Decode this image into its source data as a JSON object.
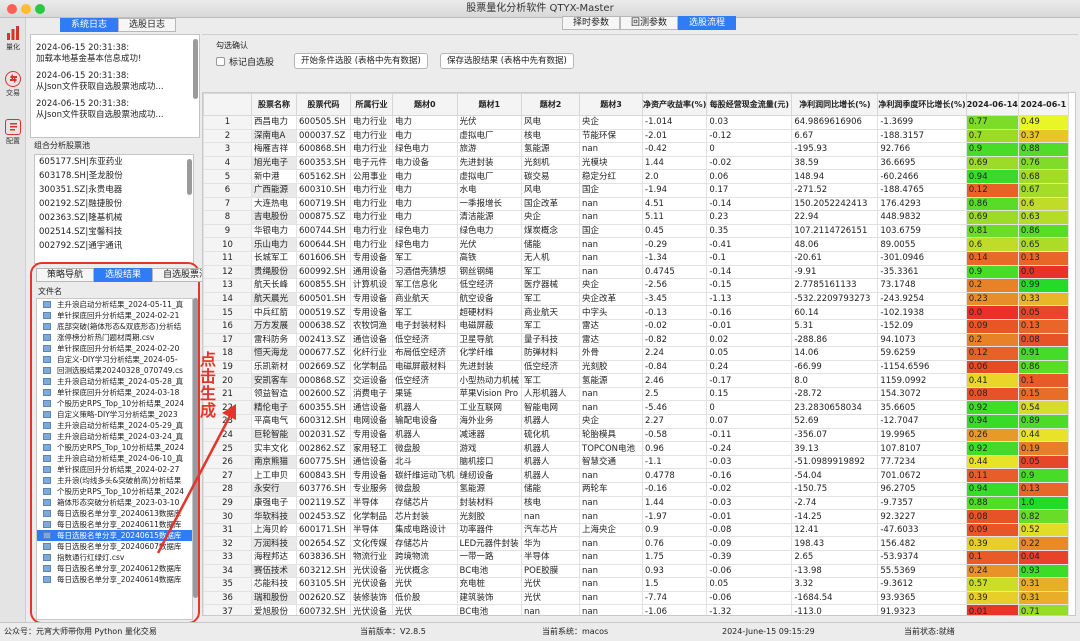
{
  "window": {
    "title": "股票量化分析软件 QTYX-Master"
  },
  "nav": [
    {
      "label": "量化",
      "icon": "bars-icon"
    },
    {
      "label": "交易",
      "icon": "exchange-icon"
    },
    {
      "label": "配置",
      "icon": "document-icon"
    }
  ],
  "left": {
    "log_tabs": [
      "系统日志",
      "选股日志"
    ],
    "logs": [
      {
        "time": "2024-06-15 20:31:38:",
        "msg": "加载本地基金基本信息成功!"
      },
      {
        "time": "2024-06-15 20:31:38:",
        "msg": "从Json文件获取自选股票池成功..."
      },
      {
        "time": "2024-06-15 20:31:38:",
        "msg": "从Json文件获取自选股票池成功..."
      }
    ],
    "pool_title": "组合分析股票池",
    "pool": [
      "605177.SH|东亚药业",
      "603178.SH|圣龙股份",
      "300351.SZ|永贵电器",
      "002192.SZ|融捷股份",
      "002363.SZ|隆基机械",
      "002514.SZ|宝馨科技",
      "002792.SZ|通宇通讯"
    ],
    "file_tabs": [
      "策略导航",
      "选股结果",
      "自选股票池"
    ],
    "tree_header": "文件名",
    "files": [
      "主升浪启动分析结果_2024-05-11_真",
      "单针探底回升分析结果_2024-02-21",
      "底部突破(箱体形态&双底形态)分析结",
      "涨停榜分析热门题材周期.csv",
      "单针探底回升分析结果_2024-02-20",
      "自定义-DIY学习分析结果_2024-05-",
      "回测选股结果20240328_070749.cs",
      "主升浪启动分析结果_2024-05-28_真",
      "单针探底回升分析结果_2024-03-18",
      "个股历史RPS_Top_10分析结果_2024",
      "自定义策略-DIY学习分析结果_2023",
      "主升浪启动分析结果_2024-05-29_真",
      "主升浪启动分析结果_2024-03-24_真",
      "个股历史RPS_Top_10分析结果_2024",
      "主升浪启动分析结果_2024-06-10_真",
      "单针探底回升分析结果_2024-02-27",
      "主升浪(均线多头&突破前高)分析结果",
      "个股历史RPS_Top_10分析结果_2024",
      "箱体形态突破分析结果_2023-03-10",
      "每日选股名单分享_20240613数据库",
      "每日选股名单分享_20240611数据库",
      "每日选股名单分享_20240615数据库",
      "每日选股名单分享_20240607数据库",
      "指数通行红绿灯.csv",
      "每日选股名单分享_20240612数据库",
      "每日选股名单分享_20240614数据库"
    ],
    "selected_index": 21
  },
  "top": {
    "tabs": [
      "择时参数",
      "回测参数",
      "选股流程"
    ],
    "active_tab": 2,
    "check_group": "勾选确认",
    "checkbox": "标记自选股",
    "btn_start": "开始条件选股 (表格中先有数据)",
    "btn_save": "保存选股结果 (表格中先有数据)"
  },
  "annotation": "点击生成",
  "table": {
    "headers": [
      "",
      "股票名称",
      "股票代码",
      "所属行业",
      "题材0",
      "题材1",
      "题材2",
      "题材3",
      "净资产收益率(%)",
      "每股经营现金流量(元)",
      "净利润同比增长(%)",
      "净利润季度环比增长(%)",
      "2024-06-14",
      "2024-06-1"
    ],
    "rows": [
      [
        "1",
        "西昌电力",
        "600505.SH",
        "电力行业",
        "电力",
        "光伏",
        "风电",
        "央企",
        "-1.014",
        "0.03",
        "64.9869616906",
        "-1.3699",
        "0.77",
        "0.49"
      ],
      [
        "2",
        "深南电A",
        "000037.SZ",
        "电力行业",
        "电力",
        "虚拟电厂",
        "核电",
        "节能环保",
        "-2.01",
        "-0.12",
        "6.67",
        "-188.3157",
        "0.7",
        "0.37"
      ],
      [
        "3",
        "梅雁吉祥",
        "600868.SH",
        "电力行业",
        "绿色电力",
        "旅游",
        "氢能源",
        "nan",
        "-0.42",
        "0",
        "-195.93",
        "92.766",
        "0.9",
        "0.88"
      ],
      [
        "4",
        "旭光电子",
        "600353.SH",
        "电子元件",
        "电力设备",
        "先进封装",
        "光刻机",
        "光模块",
        "1.44",
        "-0.02",
        "38.59",
        "36.6695",
        "0.69",
        "0.76"
      ],
      [
        "5",
        "新中港",
        "605162.SH",
        "公用事业",
        "电力",
        "虚拟电厂",
        "碳交易",
        "稳定分红",
        "2.0",
        "0.06",
        "148.94",
        "-60.2466",
        "0.94",
        "0.68"
      ],
      [
        "6",
        "广西能源",
        "600310.SH",
        "电力行业",
        "电力",
        "水电",
        "风电",
        "国企",
        "-1.94",
        "0.17",
        "-271.52",
        "-188.4765",
        "0.12",
        "0.67"
      ],
      [
        "7",
        "大连热电",
        "600719.SH",
        "电力行业",
        "电力",
        "一季报增长",
        "国企改革",
        "nan",
        "4.51",
        "-0.14",
        "150.2052242413",
        "176.4293",
        "0.86",
        "0.6"
      ],
      [
        "8",
        "吉电股份",
        "000875.SZ",
        "电力行业",
        "电力",
        "清洁能源",
        "央企",
        "nan",
        "5.11",
        "0.23",
        "22.94",
        "448.9832",
        "0.69",
        "0.63"
      ],
      [
        "9",
        "华银电力",
        "600744.SH",
        "电力行业",
        "绿色电力",
        "绿色电力",
        "煤炭概念",
        "国企",
        "0.45",
        "0.35",
        "107.2114726151",
        "103.6759",
        "0.81",
        "0.86"
      ],
      [
        "10",
        "乐山电力",
        "600644.SH",
        "电力行业",
        "绿色电力",
        "光伏",
        "储能",
        "nan",
        "-0.29",
        "-0.41",
        "48.06",
        "89.0055",
        "0.6",
        "0.65"
      ],
      [
        "11",
        "长城军工",
        "601606.SH",
        "专用设备",
        "军工",
        "高铁",
        "无人机",
        "nan",
        "-1.34",
        "-0.1",
        "-20.61",
        "-301.0946",
        "0.14",
        "0.13"
      ],
      [
        "12",
        "贵绳股份",
        "600992.SH",
        "通用设备",
        "习酒借壳猜想",
        "钢丝钢绳",
        "军工",
        "nan",
        "0.4745",
        "-0.14",
        "-9.91",
        "-35.3361",
        "0.9",
        "0.0"
      ],
      [
        "13",
        "航天长峰",
        "600855.SH",
        "计算机设",
        "军工信息化",
        "低空经济",
        "医疗器械",
        "央企",
        "-2.56",
        "-0.15",
        "2.7785161133",
        "73.1748",
        "0.2",
        "0.99"
      ],
      [
        "14",
        "航天晨光",
        "600501.SH",
        "专用设备",
        "商业航天",
        "航空设备",
        "军工",
        "央企改革",
        "-3.45",
        "-1.13",
        "-532.2209793273",
        "-243.9254",
        "0.23",
        "0.33"
      ],
      [
        "15",
        "中兵红箭",
        "000519.SZ",
        "专用设备",
        "军工",
        "超硬材料",
        "商业航天",
        "中字头",
        "-0.13",
        "-0.16",
        "60.14",
        "-102.1938",
        "0.0",
        "0.05"
      ],
      [
        "16",
        "万方发展",
        "000638.SZ",
        "农牧饲渔",
        "电子封装材料",
        "电磁屏蔽",
        "军工",
        "雷达",
        "-0.02",
        "-0.01",
        "5.31",
        "-152.09",
        "0.09",
        "0.13"
      ],
      [
        "17",
        "雷科防务",
        "002413.SZ",
        "通信设备",
        "低空经济",
        "卫星导航",
        "量子科技",
        "雷达",
        "-0.82",
        "0.02",
        "-288.86",
        "94.1073",
        "0.2",
        "0.08"
      ],
      [
        "18",
        "恒天海龙",
        "000677.SZ",
        "化纤行业",
        "布局低空经济",
        "化学纤维",
        "防弹材料",
        "外骨",
        "2.24",
        "0.05",
        "14.06",
        "59.6259",
        "0.12",
        "0.91"
      ],
      [
        "19",
        "乐凯新材",
        "002669.SZ",
        "化学制品",
        "电磁屏蔽材料",
        "先进封装",
        "低空经济",
        "光刻胶",
        "-0.84",
        "0.24",
        "-66.99",
        "-1154.6596",
        "0.06",
        "0.86"
      ],
      [
        "20",
        "安凯客车",
        "000868.SZ",
        "交运设备",
        "低空经济",
        "小型热动力机械",
        "军工",
        "氢能源",
        "2.46",
        "-0.17",
        "8.0",
        "1159.0992",
        "0.41",
        "0.1"
      ],
      [
        "21",
        "领益智造",
        "002600.SZ",
        "消费电子",
        "果链",
        "苹果Vision Pro",
        "人形机器人",
        "nan",
        "2.5",
        "0.15",
        "-28.72",
        "154.3072",
        "0.08",
        "0.15"
      ],
      [
        "22",
        "精伦电子",
        "600355.SH",
        "通信设备",
        "机器人",
        "工业互联网",
        "智能电网",
        "nan",
        "-5.46",
        "0",
        "23.2830658034",
        "35.6605",
        "0.92",
        "0.54"
      ],
      [
        "23",
        "平高电气",
        "600312.SH",
        "电网设备",
        "输配电设备",
        "海外业务",
        "机器人",
        "央企",
        "2.27",
        "0.07",
        "52.69",
        "-12.7047",
        "0.94",
        "0.89"
      ],
      [
        "24",
        "巨轮智能",
        "002031.SZ",
        "专用设备",
        "机器人",
        "减速器",
        "硫化机",
        "轮胎模具",
        "-0.58",
        "-0.11",
        "-356.07",
        "19.9965",
        "0.26",
        "0.44"
      ],
      [
        "25",
        "实丰文化",
        "002862.SZ",
        "家用轻工",
        "微盘股",
        "游戏",
        "机器人",
        "TOPCON电池",
        "0.96",
        "-0.24",
        "39.13",
        "107.8107",
        "0.92",
        "0.19"
      ],
      [
        "26",
        "南京熊猫",
        "600775.SH",
        "通信设备",
        "北斗",
        "脑机接口",
        "机器人",
        "智慧交通",
        "-1.1",
        "-0.03",
        "-51.0989919892",
        "77.7234",
        "0.44",
        "0.05"
      ],
      [
        "27",
        "上工申贝",
        "600843.SH",
        "专用设备",
        "碳纤维运动飞机",
        "缝纫设备",
        "机器人",
        "nan",
        "0.4778",
        "-0.16",
        "-54.04",
        "701.0672",
        "0.11",
        "0.9"
      ],
      [
        "28",
        "永安行",
        "603776.SH",
        "专业服务",
        "微盘股",
        "氢能源",
        "储能",
        "两轮车",
        "-0.16",
        "-0.02",
        "-150.75",
        "96.2705",
        "0.94",
        "0.13"
      ],
      [
        "29",
        "康强电子",
        "002119.SZ",
        "半导体",
        "存储芯片",
        "封装材料",
        "核电",
        "nan",
        "1.44",
        "-0.03",
        "-2.74",
        "-9.7357",
        "0.88",
        "1.0"
      ],
      [
        "30",
        "华软科技",
        "002453.SZ",
        "化学制品",
        "芯片封装",
        "光刻胶",
        "nan",
        "nan",
        "-1.97",
        "-0.01",
        "-14.25",
        "92.3227",
        "0.08",
        "0.82"
      ],
      [
        "31",
        "上海贝岭",
        "600171.SH",
        "半导体",
        "集成电路设计",
        "功率器件",
        "汽车芯片",
        "上海央企",
        "0.9",
        "-0.08",
        "12.41",
        "-47.6033",
        "0.09",
        "0.52"
      ],
      [
        "32",
        "万润科技",
        "002654.SZ",
        "文化传媒",
        "存储芯片",
        "LED元器件封装",
        "华为",
        "nan",
        "0.76",
        "-0.09",
        "198.43",
        "156.482",
        "0.39",
        "0.22"
      ],
      [
        "33",
        "海程邦达",
        "603836.SH",
        "物流行业",
        "跨境物流",
        "一带一路",
        "半导体",
        "nan",
        "1.75",
        "-0.39",
        "2.65",
        "-53.9374",
        "0.1",
        "0.04"
      ],
      [
        "34",
        "赛伍技术",
        "603212.SH",
        "光伏设备",
        "光伏概念",
        "BC电池",
        "POE胶膜",
        "nan",
        "0.93",
        "-0.06",
        "-13.98",
        "55.5369",
        "0.24",
        "0.93"
      ],
      [
        "35",
        "芯能科技",
        "603105.SH",
        "光伏设备",
        "光伏",
        "充电桩",
        "光伏",
        "nan",
        "1.5",
        "0.05",
        "3.32",
        "-9.3612",
        "0.57",
        "0.31"
      ],
      [
        "36",
        "瑞和股份",
        "002620.SZ",
        "装修装饰",
        "低价股",
        "建筑装饰",
        "光伏",
        "nan",
        "-7.74",
        "-0.06",
        "-1684.54",
        "93.9365",
        "0.39",
        "0.31"
      ],
      [
        "37",
        "爱旭股份",
        "600732.SH",
        "光伏设备",
        "光伏",
        "BC电池",
        "nan",
        "nan",
        "-1.06",
        "-1.32",
        "-113.0",
        "91.9323",
        "0.01",
        "0.71"
      ],
      [
        "38",
        "通源股份",
        "600638.SH",
        "光伏设备",
        "光伏充电桩",
        "BIPV",
        "光伏概念",
        "nan",
        "0.8",
        "-0.02",
        "-39.23",
        "-54.5578",
        "0.29",
        "0.3"
      ]
    ]
  },
  "status": {
    "left": "公众号：元宵大师带你用 Python 量化交易",
    "version": "当前版本：V2.8.5",
    "system": "当前系统：macos",
    "time": "2024-June-15 09:15:29",
    "state": "当前状态:就绪"
  }
}
